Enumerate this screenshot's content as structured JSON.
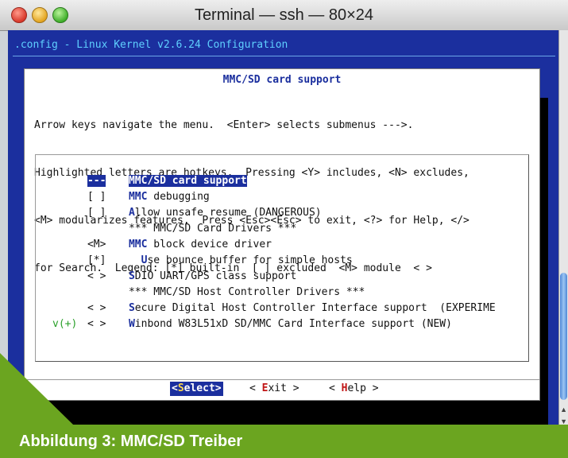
{
  "window": {
    "title": "Terminal — ssh — 80×24"
  },
  "terminal": {
    "config_title": ".config - Linux Kernel v2.6.24 Configuration",
    "dialog": {
      "title": "MMC/SD card support",
      "help_lines": [
        "Arrow keys navigate the menu.  <Enter> selects submenus --->.",
        "Highlighted letters are hotkeys.  Pressing <Y> includes, <N> excludes,",
        "<M> modularizes features.  Press <Esc><Esc> to exit, <?> for Help, </>",
        "for Search.  Legend: [*] built-in  [ ] excluded  <M> module  < >"
      ],
      "items": [
        {
          "flag": "---",
          "hot": "",
          "rest": "MMC/SD card support",
          "highlighted": true
        },
        {
          "flag": "[ ]",
          "hot": "MMC",
          "rest": " debugging"
        },
        {
          "flag": "[ ]",
          "hot": "A",
          "rest": "llow unsafe resume (DANGEROUS)"
        },
        {
          "flag": "",
          "hot": "",
          "rest": "*** MMC/SD Card Drivers ***"
        },
        {
          "flag": "<M>",
          "hot": "MMC",
          "rest": " block device driver"
        },
        {
          "flag": "[*]",
          "hot": "  U",
          "rest": "se bounce buffer for simple hosts"
        },
        {
          "flag": "< >",
          "hot": "S",
          "rest": "DIO UART/GPS class support"
        },
        {
          "flag": "",
          "hot": "",
          "rest": "*** MMC/SD Host Controller Drivers ***"
        },
        {
          "flag": "< >",
          "hot": "S",
          "rest": "ecure Digital Host Controller Interface support  (EXPERIME"
        },
        {
          "flag": "< >",
          "hot": "W",
          "rest": "inbond W83L51xD SD/MMC Card Interface support (NEW)"
        }
      ],
      "more_indicator": "v(+)",
      "buttons": {
        "select": {
          "open": "<",
          "hot": "S",
          "rest": "elect",
          "close": ">"
        },
        "exit": {
          "open": "< ",
          "hot": "E",
          "rest": "xit",
          "close": " >"
        },
        "help": {
          "open": "< ",
          "hot": "H",
          "rest": "elp",
          "close": " >"
        }
      }
    }
  },
  "caption": "Abbildung 3: MMC/SD Treiber"
}
